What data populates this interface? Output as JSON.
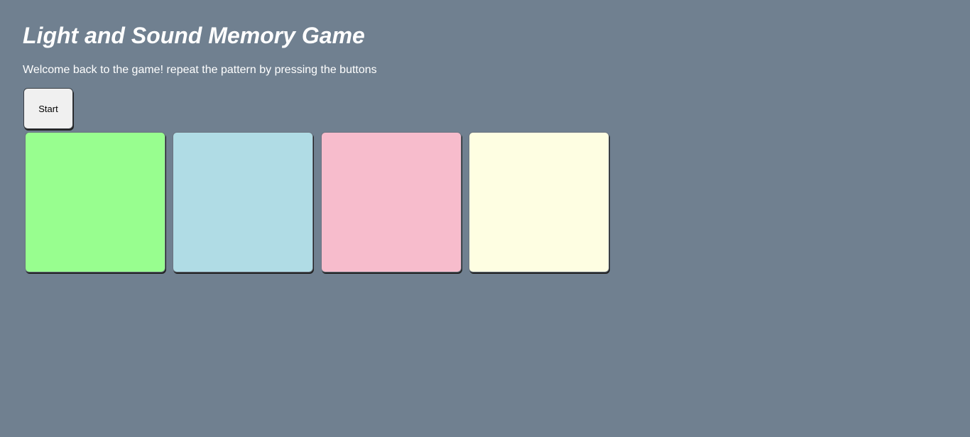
{
  "header": {
    "title": "Light and Sound Memory Game",
    "subtitle": "Welcome back to the game! repeat the pattern by pressing the buttons"
  },
  "controls": {
    "start_label": "Start"
  },
  "game_buttons": [
    {
      "id": "1",
      "color": "#98fe8f"
    },
    {
      "id": "2",
      "color": "#b0dce5"
    },
    {
      "id": "3",
      "color": "#f7bccc"
    },
    {
      "id": "4",
      "color": "#fefee2"
    }
  ],
  "colors": {
    "background": "#708090",
    "text": "#ffffff"
  }
}
